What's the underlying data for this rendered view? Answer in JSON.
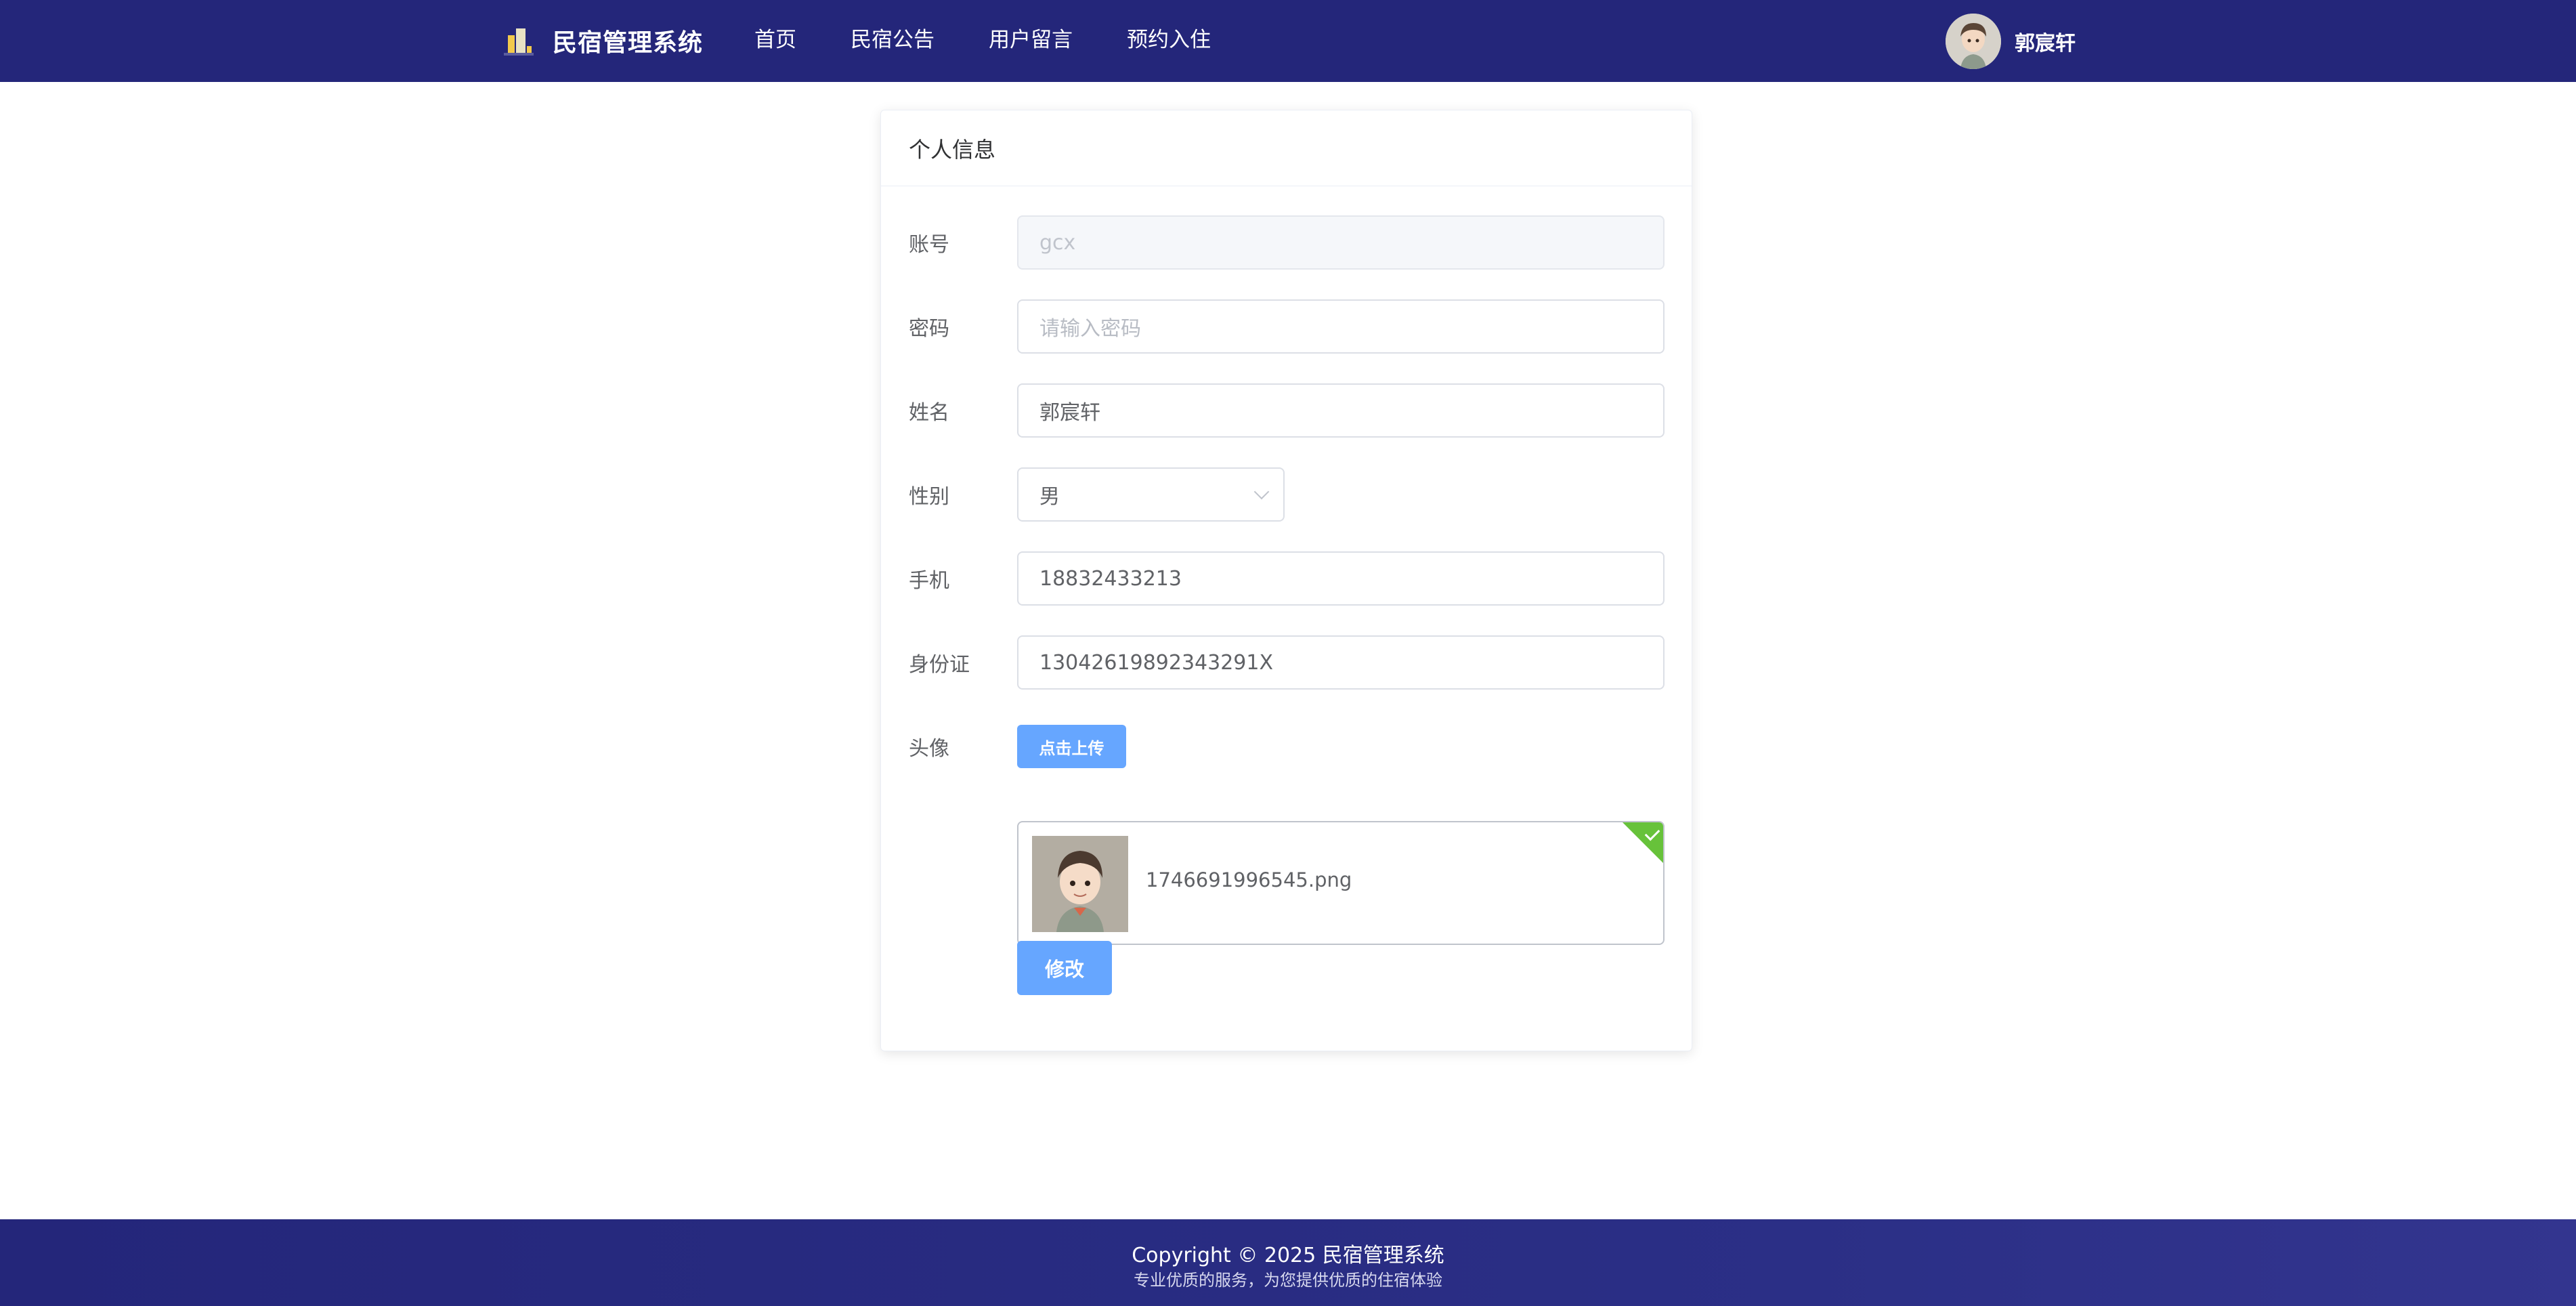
{
  "header": {
    "brand_title": "民宿管理系统",
    "nav": [
      "首页",
      "民宿公告",
      "用户留言",
      "预约入住"
    ],
    "user_name": "郭宸轩"
  },
  "card": {
    "title": "个人信息",
    "fields": {
      "account": {
        "label": "账号",
        "value": "gcx"
      },
      "password": {
        "label": "密码",
        "placeholder": "请输入密码"
      },
      "name": {
        "label": "姓名",
        "value": "郭宸轩"
      },
      "gender": {
        "label": "性别",
        "value": "男"
      },
      "phone": {
        "label": "手机",
        "value": "18832433213"
      },
      "id_card": {
        "label": "身份证",
        "value": "13042619892343291X"
      },
      "avatar": {
        "label": "头像",
        "upload_label": "点击上传",
        "file_name": "1746691996545.png"
      }
    },
    "submit_label": "修改"
  },
  "footer": {
    "copyright": "Copyright © 2025 民宿管理系统",
    "tagline": "专业优质的服务，为您提供优质的住宿体验"
  },
  "colors": {
    "header_bg": "#24267a",
    "primary_button": "#66a6ff",
    "success": "#67c23a"
  }
}
